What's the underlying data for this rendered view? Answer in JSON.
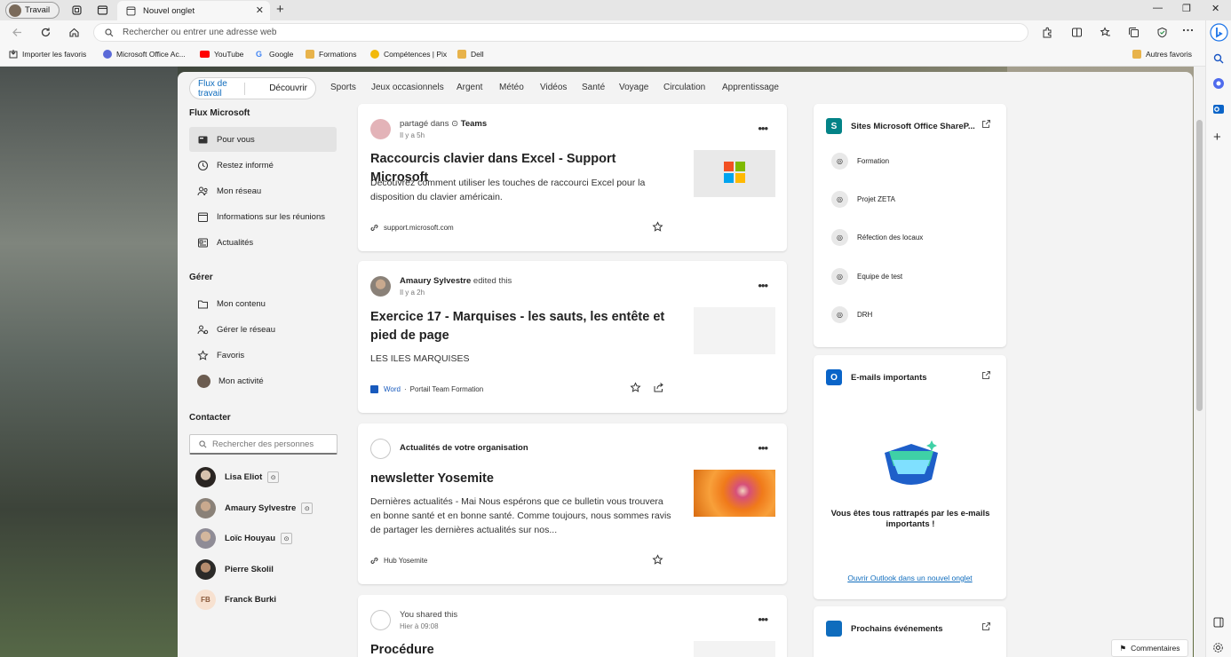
{
  "browser": {
    "profile_label": "Travail",
    "tab_title": "Nouvel onglet",
    "address_placeholder": "Rechercher ou entrer une adresse web",
    "favorites": [
      {
        "label": "Importer les favoris",
        "icon": "import-icon"
      },
      {
        "label": "Microsoft Office Ac...",
        "icon": "office-icon"
      },
      {
        "label": "YouTube",
        "icon": "youtube-icon"
      },
      {
        "label": "Google",
        "icon": "google-icon"
      },
      {
        "label": "Formations",
        "icon": "folder-icon"
      },
      {
        "label": "Compétences | Pix",
        "icon": "pix-icon"
      },
      {
        "label": "Dell",
        "icon": "folder-icon"
      }
    ],
    "other_favorites": "Autres favoris"
  },
  "tabs": {
    "segment": [
      "Flux de travail",
      "Découvrir"
    ],
    "categories": [
      "Sports",
      "Jeux occasionnels",
      "Argent",
      "Météo",
      "Vidéos",
      "Santé",
      "Voyage",
      "Circulation",
      "Apprentissage"
    ]
  },
  "leftnav": {
    "section1_title": "Flux Microsoft",
    "section1_items": [
      "Pour vous",
      "Restez informé",
      "Mon réseau",
      "Informations sur les réunions",
      "Actualités"
    ],
    "section2_title": "Gérer",
    "section2_items": [
      "Mon contenu",
      "Gérer le réseau",
      "Favoris",
      "Mon activité"
    ],
    "section3_title": "Contacter",
    "people_search_placeholder": "Rechercher des personnes",
    "people": [
      "Lisa Eliot",
      "Amaury Sylvestre",
      "Loïc Houyau",
      "Pierre Skolil",
      "Franck Burki"
    ],
    "franck_initials": "FB"
  },
  "feed": [
    {
      "header_prefix": "partagé dans",
      "header_source": "Teams",
      "time": "Il y a 5h",
      "title": "Raccourcis clavier dans Excel - Support Microsoft",
      "description": "Découvrez comment utiliser les touches de raccourci Excel pour la disposition du clavier américain.",
      "footer": "support.microsoft.com"
    },
    {
      "header_author": "Amaury Sylvestre",
      "header_action": "edited this",
      "time": "Il y a 2h",
      "title": "Exercice 17 - Marquises - les sauts, les entête et pied de page",
      "description": "LES ILES MARQUISES",
      "footer_app": "Word",
      "footer_sep": "·",
      "footer_location": "Portail Team Formation"
    },
    {
      "header_title": "Actualités de votre organisation",
      "title": "newsletter Yosemite",
      "description": "Dernières actualités - Mai Nous espérons que ce bulletin vous trouvera en bonne santé et en bonne santé. Comme toujours, nous sommes ravis de partager les dernières actualités sur nos...",
      "footer": "Hub Yosemite"
    },
    {
      "header_action": "You shared this",
      "time": "Hier à 09:08",
      "title": "Procédure"
    }
  ],
  "right": {
    "sharepoint_title": "Sites Microsoft Office ShareP...",
    "sites": [
      "Formation",
      "Projet ZETA",
      "Réfection des locaux",
      "Equipe de test",
      "DRH"
    ],
    "email_title": "E-mails importants",
    "email_message": "Vous êtes tous rattrapés par les e-mails importants !",
    "email_link": "Ouvrir Outlook dans un nouvel onglet",
    "events_title": "Prochains événements"
  },
  "feedback_label": "Commentaires",
  "colors": {
    "accent": "#0f6cbd",
    "youtube": "#ff0000",
    "folder": "#e8b34b"
  }
}
